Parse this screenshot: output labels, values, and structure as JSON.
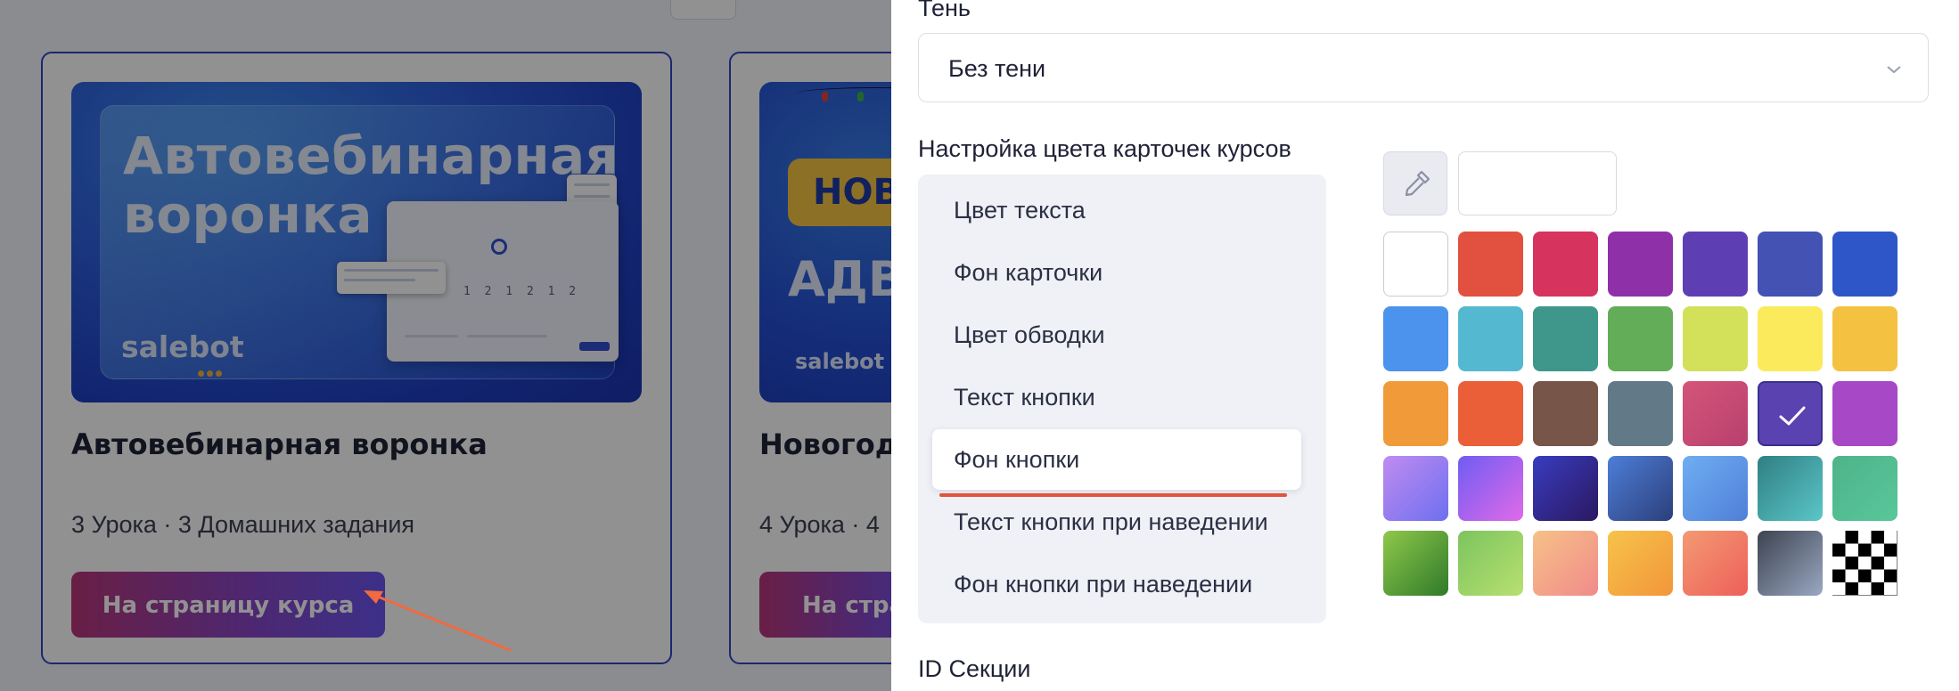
{
  "background": {
    "card1": {
      "cover_title": "Автовебинарная воронка",
      "cover_brand": "salebot",
      "mock_numbers": "1 2 1 2 1 2",
      "title": "Автовебинарная воронка",
      "meta": "3 Урока · 3 Домашних задания",
      "button": "На страницу курса"
    },
    "card2": {
      "cover_badge": "НОВО",
      "cover_word": "АДВЕ",
      "cover_brand": "salebot",
      "title": "Новогод",
      "meta": "4 Урока · 4",
      "button": "На стра"
    }
  },
  "panel": {
    "shadow_label": "Тень",
    "shadow_value": "Без тени",
    "card_color_label": "Настройка цвета карточек курсов",
    "tabs": [
      {
        "label": "Цвет текста",
        "active": false
      },
      {
        "label": "Фон карточки",
        "active": false
      },
      {
        "label": "Цвет обводки",
        "active": false
      },
      {
        "label": "Текст кнопки",
        "active": false
      },
      {
        "label": "Фон кнопки",
        "active": true
      },
      {
        "label": "Текст кнопки при наведении",
        "active": false
      },
      {
        "label": "Фон кнопки при наведении",
        "active": false
      }
    ],
    "hex_value": "",
    "section_id_label": "ID Секции",
    "accent_color": "#e4533c",
    "swatches": [
      [
        "#ffffff",
        "#e2513f",
        "#d6335f",
        "#8e31a8",
        "#5e3fb3",
        "#4352b3",
        "#2f56c8"
      ],
      [
        "#4b93ec",
        "#54b8d0",
        "#3e978a",
        "#63ad59",
        "#d2e05a",
        "#fbea5b",
        "#f5c140"
      ],
      [
        "#f19a3a",
        "#ea5e38",
        "#775548",
        "#627a88",
        "linear-gradient(135deg,#d4557a,#b8406e)",
        "#5a43b0",
        "#a748c7"
      ],
      [
        "linear-gradient(135deg,#c08cf0,#6d6ff0)",
        "linear-gradient(135deg,#6f5cf3,#e06ae8)",
        "linear-gradient(135deg,#3a3cc0,#2a1860)",
        "linear-gradient(135deg,#4d7ed8,#2c3f7a)",
        "linear-gradient(135deg,#6faef2,#4f7fd8)",
        "linear-gradient(135deg,#2f7f82,#5bc6c8)",
        "linear-gradient(135deg,#4fb38a,#58c79a)"
      ],
      [
        "linear-gradient(135deg,#8fc84a,#2f7a2a)",
        "linear-gradient(135deg,#7cc45f,#b8e070)",
        "linear-gradient(135deg,#f7c188,#f08b8a)",
        "linear-gradient(135deg,#f7c34a,#f2963a)",
        "linear-gradient(135deg,#f39a72,#ee5f5a)",
        "linear-gradient(135deg,#3d4350,#9aa8c3)",
        "checker"
      ]
    ],
    "selected_swatch": [
      2,
      5
    ]
  }
}
